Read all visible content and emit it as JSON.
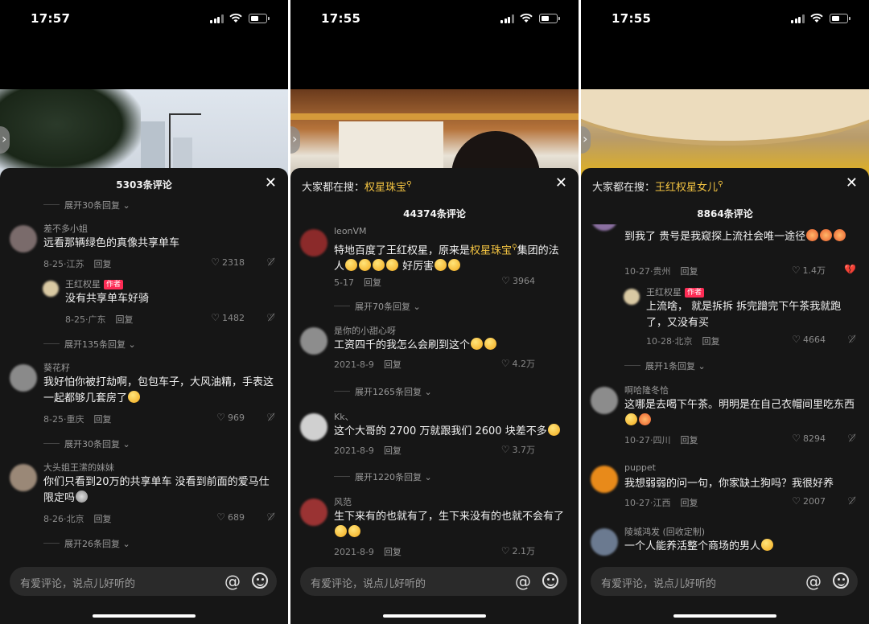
{
  "phones": [
    {
      "status_time": "17:57",
      "comment_count": "5303条评论",
      "input_placeholder": "有爱评论，说点儿好听的",
      "items": [
        {
          "type": "expand",
          "label": "展开30条回复"
        },
        {
          "type": "comment",
          "user": "差不多小姐",
          "text": "远看那辆绿色的真像共享单车",
          "date": "8-25·江苏",
          "reply": "回复",
          "likes": "2318"
        },
        {
          "type": "reply",
          "user": "王红权星",
          "badge": "作者",
          "text": "没有共享单车好骑",
          "date": "8-25·广东",
          "reply": "回复",
          "likes": "1482"
        },
        {
          "type": "expand",
          "label": "展开135条回复"
        },
        {
          "type": "comment",
          "user": "葵花籽",
          "text": "我好怕你被打劫啊，包包车子，大风油精，手表这一起都够几套房了",
          "emoji_count": 1,
          "date": "8-25·重庆",
          "reply": "回复",
          "likes": "969"
        },
        {
          "type": "expand",
          "label": "展开30条回复"
        },
        {
          "type": "comment",
          "user": "大头姐王潆的妹妹",
          "text": "你们只看到20万的共享单车 没看到前面的爱马仕限定吗",
          "emoji_count": 1,
          "date": "8-26·北京",
          "reply": "回复",
          "likes": "689"
        },
        {
          "type": "expand",
          "label": "展开26条回复"
        }
      ]
    },
    {
      "status_time": "17:55",
      "searching_label": "大家都在搜：",
      "searching_term": "权星珠宝",
      "comment_count": "44374条评论",
      "input_placeholder": "有爱评论，说点儿好听的",
      "items": [
        {
          "type": "comment",
          "user": "leonVM",
          "text_before": "特地百度了王红权星，原来是",
          "text_hl": "权星珠宝",
          "text_after": "集团的法人",
          "emoji_count": 4,
          "text_tail": " 好厉害",
          "tail_emoji": 2,
          "date": "5-17",
          "reply": "回复",
          "likes": "3964"
        },
        {
          "type": "expand",
          "label": "展开70条回复"
        },
        {
          "type": "comment",
          "user": "是你的小甜心呀",
          "text": "工资四千的我怎么会刷到这个",
          "emoji_count": 2,
          "date": "2021-8-9",
          "reply": "回复",
          "likes": "4.2万"
        },
        {
          "type": "expand",
          "label": "展开1265条回复"
        },
        {
          "type": "comment",
          "user": "Kk、",
          "text": "这个大哥的 2700 万就跟我们 2600 块差不多",
          "emoji_count": 1,
          "date": "2021-8-9",
          "reply": "回复",
          "likes": "3.7万"
        },
        {
          "type": "expand",
          "label": "展开1220条回复"
        },
        {
          "type": "comment",
          "user": "风范",
          "text": "生下来有的也就有了，生下来没有的也就不会有了",
          "emoji_count": 2,
          "date": "2021-8-9",
          "reply": "回复",
          "likes": "2.1万"
        }
      ]
    },
    {
      "status_time": "17:55",
      "searching_label": "大家都在搜：",
      "searching_term": "王红权星女儿",
      "comment_count": "8864条评论",
      "input_placeholder": "有爱评论，说点儿好听的",
      "items": [
        {
          "type": "comment",
          "user": "",
          "text": "到我了 贵号是我窥探上流社会唯一途径",
          "emoji_count": 3,
          "date": "10-27·贵州",
          "reply": "回复",
          "likes": "1.4万"
        },
        {
          "type": "reply",
          "user": "王红权星",
          "badge": "作者",
          "text": "上流啥， 就是拆拆 拆完蹭完下午茶我就跑了，又没有买",
          "date": "10-28·北京",
          "reply": "回复",
          "likes": "4664"
        },
        {
          "type": "expand",
          "label": "展开1条回复"
        },
        {
          "type": "comment",
          "user": "啊哈隆冬恰",
          "text": "这哪是去喝下午茶。明明是在自己衣帽间里吃东西",
          "emoji_count": 2,
          "date": "10-27·四川",
          "reply": "回复",
          "likes": "8294"
        },
        {
          "type": "comment",
          "user": "puppet",
          "text": "我想弱弱的问一句，你家缺土狗吗？我很好养",
          "date": "10-27·江西",
          "reply": "回复",
          "likes": "2007"
        },
        {
          "type": "comment",
          "user": "陵城鸿发 (回收定制)",
          "text": "一个人能养活整个商场的男人",
          "emoji_count": 1
        }
      ]
    }
  ]
}
